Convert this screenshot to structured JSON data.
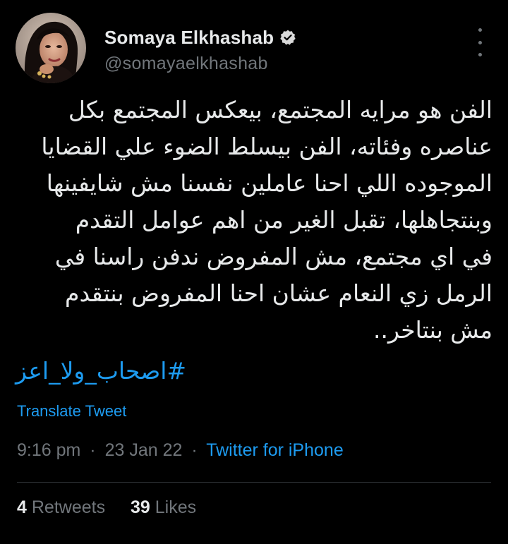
{
  "author": {
    "display_name": "Somaya Elkhashab",
    "handle": "@somayaelkhashab",
    "verified": true
  },
  "tweet": {
    "lines": [
      "الفن هو مرايه المجتمع، بيعكس المجتمع بكل",
      "عناصره وفئاته، الفن بيسلط الضوء علي القضايا",
      "الموجوده اللي احنا عاملين نفسنا مش شايفينها",
      "وبنتجاهلها، تقبل الغير من اهم عوامل التقدم",
      "في اي مجتمع، مش المفروض ندفن راسنا في",
      "الرمل زي النعام عشان احنا المفروض بنتقدم",
      "مش بنتاخر.."
    ],
    "hashtag": "#اصحاب_ولا_اعز"
  },
  "translate_label": "Translate Tweet",
  "meta": {
    "time": "9:16 pm",
    "date": "23 Jan 22",
    "source": "Twitter for iPhone",
    "separator": "·"
  },
  "stats": {
    "retweets_count": "4",
    "retweets_label": "Retweets",
    "likes_count": "39",
    "likes_label": "Likes"
  },
  "icons": {
    "verified": "verified-badge-icon",
    "more": "more-options-icon"
  },
  "colors": {
    "background": "#000000",
    "text": "#e7e9ea",
    "secondary": "#71767b",
    "accent": "#1d9bf0",
    "divider": "#2f3336"
  }
}
